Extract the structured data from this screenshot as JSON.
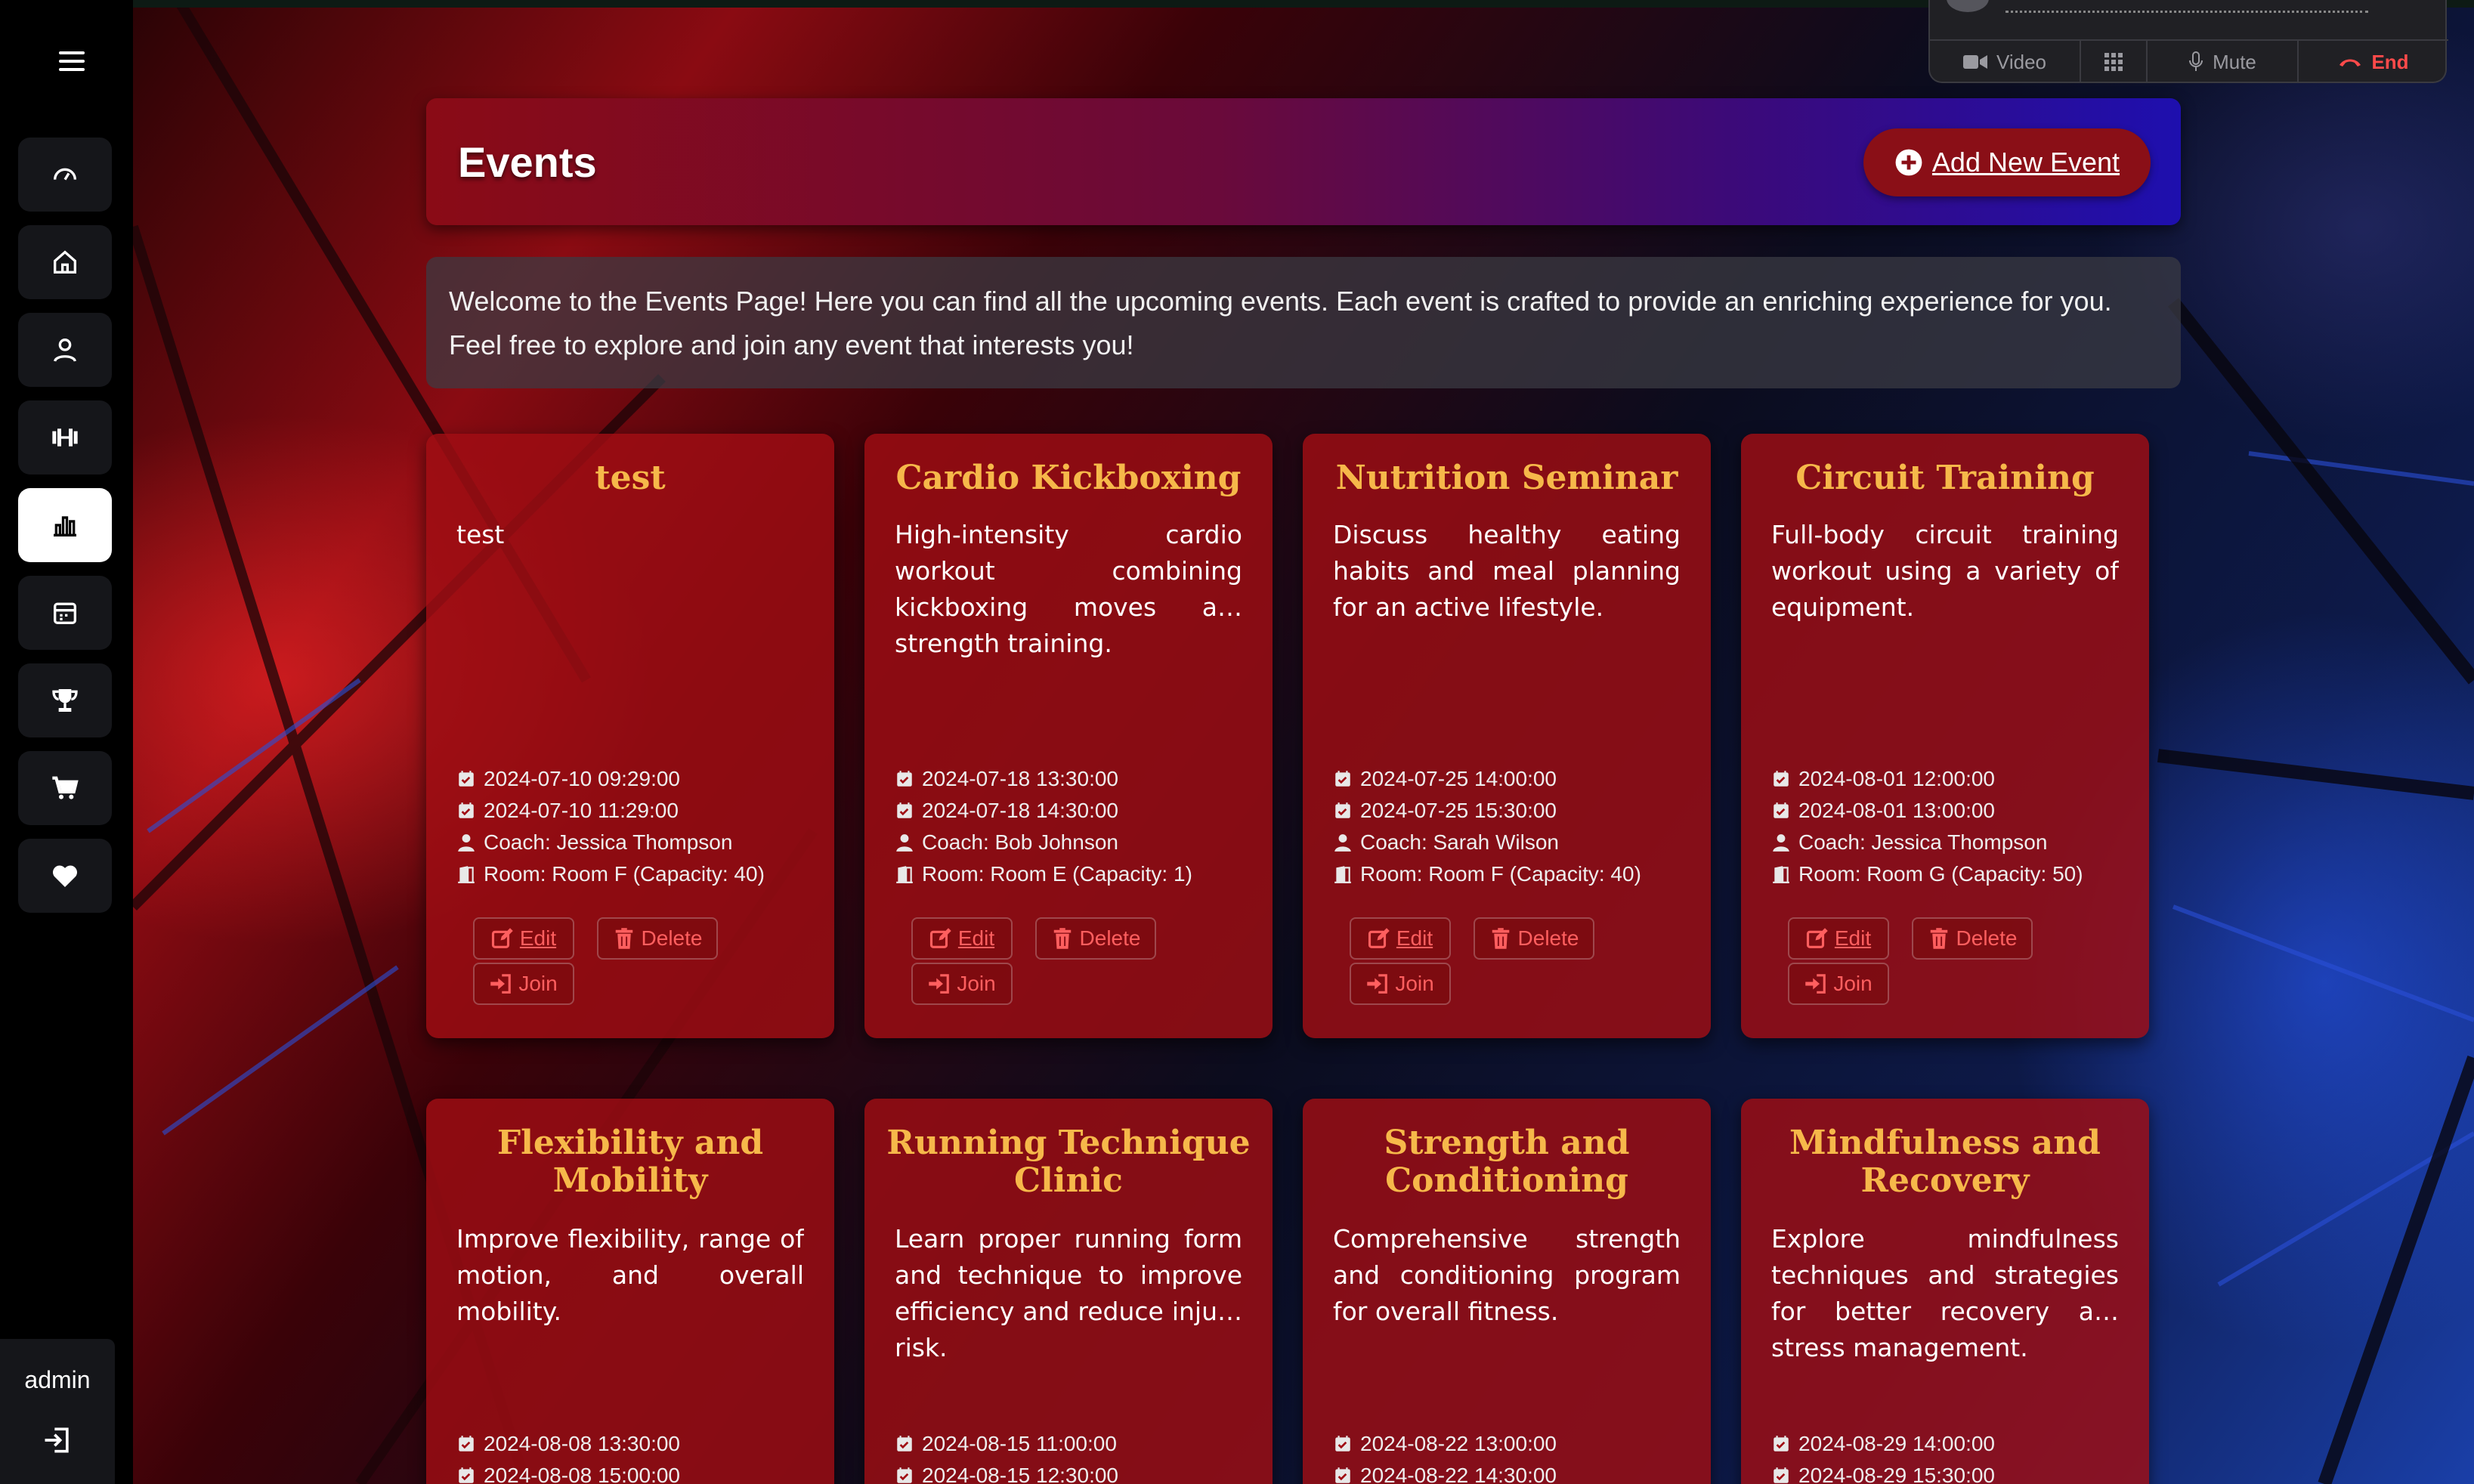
{
  "sidebar": {
    "items": [
      {
        "name": "dashboard"
      },
      {
        "name": "home"
      },
      {
        "name": "profile"
      },
      {
        "name": "workouts"
      },
      {
        "name": "stats",
        "active": true
      },
      {
        "name": "calendar"
      },
      {
        "name": "trophies"
      },
      {
        "name": "shop"
      },
      {
        "name": "favorites"
      }
    ],
    "user": "admin"
  },
  "call": {
    "video_label": "Video",
    "mute_label": "Mute",
    "end_label": "End"
  },
  "header": {
    "title": "Events",
    "add_label": "Add New Event"
  },
  "welcome": {
    "text": "Welcome to the Events Page! Here you can find all the upcoming events. Each event is crafted to provide an enriching experience for you. Feel free to explore and join any event that interests you!"
  },
  "buttons": {
    "edit": "Edit",
    "delete": "Delete",
    "join": "Join"
  },
  "events": [
    {
      "title": "test",
      "description": "test",
      "start": "2024-07-10 09:29:00",
      "end": "2024-07-10 11:29:00",
      "coach": "Coach: Jessica Thompson",
      "room": "Room: Room F (Capacity: 40)"
    },
    {
      "title": "Cardio Kickboxing",
      "description": "High-intensity cardio workout combining kickboxing moves a… strength training.",
      "start": "2024-07-18 13:30:00",
      "end": "2024-07-18 14:30:00",
      "coach": "Coach: Bob Johnson",
      "room": "Room: Room E (Capacity: 1)"
    },
    {
      "title": "Nutrition Seminar",
      "description": "Discuss healthy eating habits and meal planning for an active lifestyle.",
      "start": "2024-07-25 14:00:00",
      "end": "2024-07-25 15:30:00",
      "coach": "Coach: Sarah Wilson",
      "room": "Room: Room F (Capacity: 40)"
    },
    {
      "title": "Circuit Training",
      "description": "Full-body circuit training workout using a variety of equipment.",
      "start": "2024-08-01 12:00:00",
      "end": "2024-08-01 13:00:00",
      "coach": "Coach: Jessica Thompson",
      "room": "Room: Room G (Capacity: 50)"
    },
    {
      "title": "Flexibility and Mobility",
      "description": "Improve flexibility, range of motion, and overall mobility.",
      "start": "2024-08-08 13:30:00",
      "end": "2024-08-08 15:00:00"
    },
    {
      "title": "Running Technique Clinic",
      "description": "Learn proper running form and technique to improve efficiency and reduce inju… risk.",
      "start": "2024-08-15 11:00:00",
      "end": "2024-08-15 12:30:00"
    },
    {
      "title": "Strength and Conditioning",
      "description": "Comprehensive strength and conditioning program for overall fitness.",
      "start": "2024-08-22 13:00:00",
      "end": "2024-08-22 14:30:00"
    },
    {
      "title": "Mindfulness and Recovery",
      "description": "Explore mindfulness techniques and strategies for better recovery a… stress management.",
      "start": "2024-08-29 14:00:00",
      "end": "2024-08-29 15:30:00"
    }
  ],
  "colors": {
    "card_title": "#f6b84a",
    "card_bg": "#a00e14",
    "button_text": "#ff5f5f",
    "end_call": "#ff4a4a"
  }
}
